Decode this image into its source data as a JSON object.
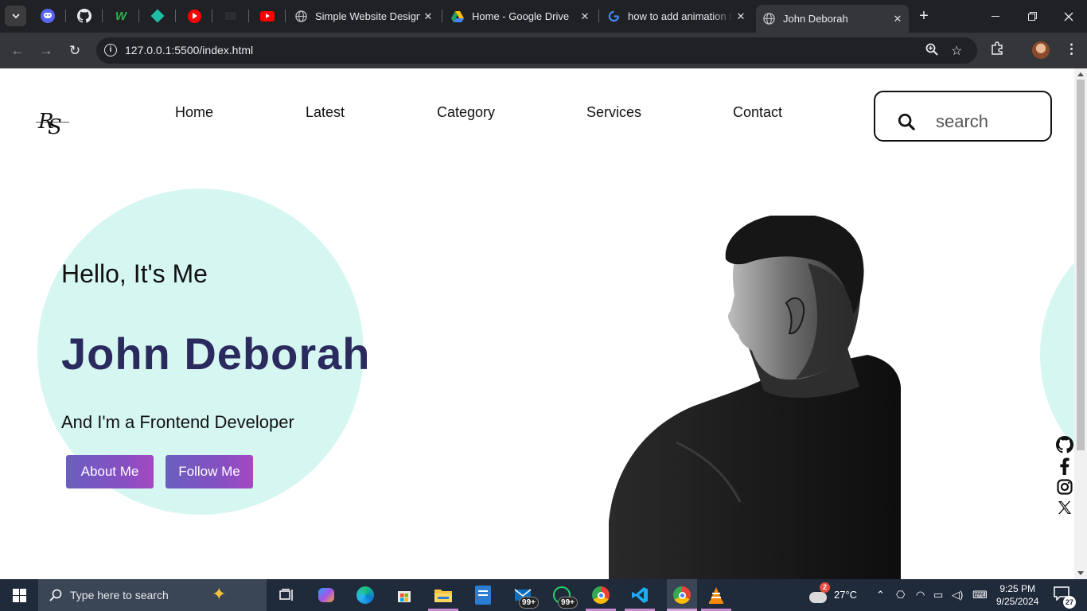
{
  "browser": {
    "pinned_tabs": [
      "discord-icon",
      "github-icon",
      "webflow-icon",
      "diamond-app-icon",
      "youtube-music-icon",
      "blank-tab-icon",
      "youtube-icon"
    ],
    "tabs": [
      {
        "title": "Simple Website Design",
        "icon": "globe-icon",
        "active": false
      },
      {
        "title": "Home - Google Drive",
        "icon": "google-drive-icon",
        "active": false
      },
      {
        "title": "how to add animation t",
        "icon": "google-icon",
        "active": false
      },
      {
        "title": "John Deborah",
        "icon": "globe-icon",
        "active": true
      }
    ],
    "url": "127.0.0.1:5500/index.html"
  },
  "site": {
    "nav": [
      "Home",
      "Latest",
      "Category",
      "Services",
      "Contact"
    ],
    "search_placeholder": "search",
    "hero": {
      "greeting": "Hello, It's Me",
      "name": "John Deborah",
      "tagline": "And I'm a Frontend Developer",
      "buttons": [
        "About Me",
        "Follow Me"
      ]
    },
    "social": [
      "github-icon",
      "facebook-icon",
      "instagram-icon",
      "x-icon"
    ],
    "colors": {
      "accent_circle": "#d6f7f1",
      "name_color": "#2a2a5e",
      "button_gradient_start": "#6a5fbf",
      "button_gradient_end": "#a549c2"
    }
  },
  "taskbar": {
    "search_placeholder": "Type here to search",
    "mail_badge": "99+",
    "whatsapp_badge": "99+",
    "weather_badge": "2",
    "temperature": "27°C",
    "time": "9:25 PM",
    "date": "9/25/2024",
    "notifications": "27"
  }
}
